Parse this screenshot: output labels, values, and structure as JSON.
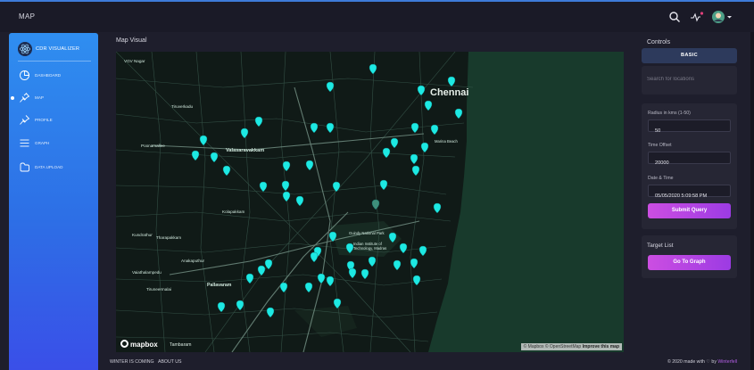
{
  "header": {
    "title": "MAP"
  },
  "brand": {
    "name": "CDR VISUALIZER"
  },
  "nav": [
    {
      "label": "DASHBOARD"
    },
    {
      "label": "MAP"
    },
    {
      "label": "PROFILE"
    },
    {
      "label": "GRAPH"
    },
    {
      "label": "DATA UPLOAD"
    }
  ],
  "map": {
    "title": "Map Visual",
    "labels": {
      "city": "Chennai",
      "vgv_nagar": "VGV Nagar",
      "tiruverkadu": "Tiruverkadu",
      "poonamallee": "Poonamallee",
      "valasaravakkam": "Valasaravakkam",
      "kolapakkam": "Kolapakkam",
      "kundrathur": "Kundrathur",
      "tharapakkam": "Tharapakkam",
      "anakaputhur": "Anakaputhur",
      "vaiathalampedu": "Vaiathalampedu",
      "tiruneermalai": "Tiruneermalai",
      "pallavaram": "Pallavaram",
      "guindy": "Guindy National Park",
      "iit": "Indian Institute of Technology, Madras",
      "marina": "Marina Beach",
      "tambaram": "Tambaram"
    },
    "logo": "mapbox",
    "attribution": "© Mapbox © OpenStreetMap",
    "improve": "Improve this map"
  },
  "controls": {
    "title": "Controls",
    "basic_label": "BASIC",
    "search_placeholder": "Search for locations",
    "radius_label": "Radius in kms (1-50)",
    "radius_value": "50",
    "offset_label": "Time Offset",
    "offset_value": "20000",
    "datetime_label": "Date & Time",
    "datetime_value": "05/05/2020 5:09:58 PM",
    "submit_label": "Submit Query"
  },
  "target": {
    "title": "Target List",
    "button_label": "Go To Graph"
  },
  "footer": {
    "link1": "WINTER IS COMING",
    "link2": "ABOUT US",
    "copyright": "© 2020 made with ♡ by",
    "author": "Winterfell"
  },
  "colors": {
    "accent": "#2f8ef0",
    "marker": "#1de9e3",
    "button": "#c04be2",
    "map_bg": "#121d19"
  },
  "icons": [
    "search-icon",
    "activity-icon",
    "avatar-icon",
    "dashboard-icon",
    "map-pin-icon",
    "profile-icon",
    "graph-icon",
    "upload-icon"
  ]
}
